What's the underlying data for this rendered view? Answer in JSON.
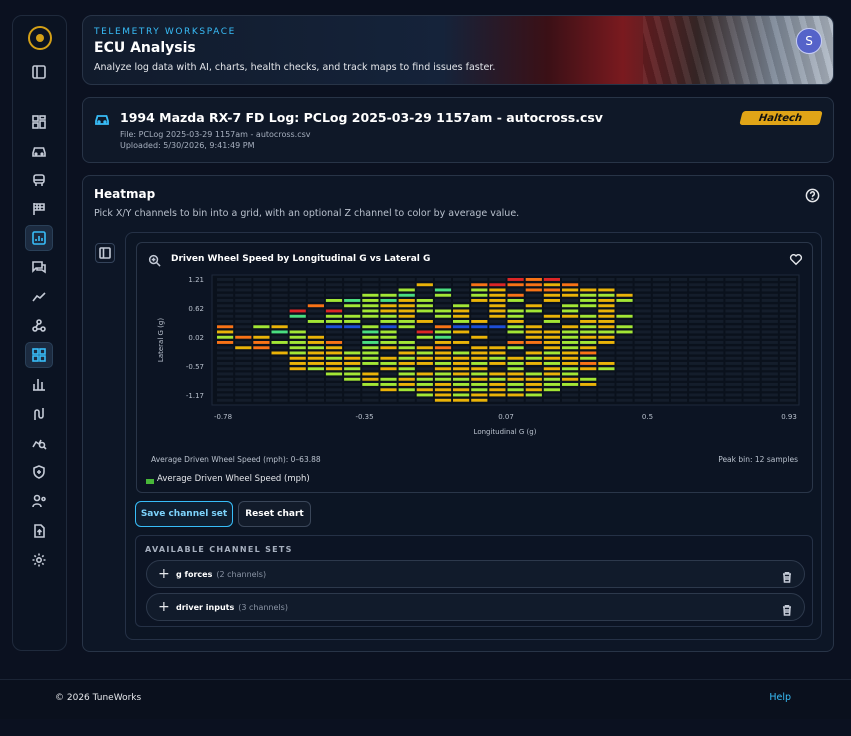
{
  "banner": {
    "workspace": "TELEMETRY WORKSPACE",
    "title": "ECU Analysis",
    "subtitle": "Analyze log data with AI, charts, health checks, and track maps to find issues faster.",
    "avatar_initial": "S"
  },
  "log": {
    "title": "1994 Mazda RX-7 FD Log: PCLog 2025-03-29 1157am - autocross.csv",
    "file": "File: PCLog 2025-03-29 1157am - autocross.csv",
    "uploaded": "Uploaded: 5/30/2026, 9:41:49 PM",
    "brand": "Haltech"
  },
  "sidebar": {
    "icons": [
      "dashboard-icon",
      "car-icon",
      "vehicle-icon",
      "flag-icon",
      "heatmap-icon",
      "chat-icon",
      "line-chart-icon",
      "graph-icon",
      "grid-icon",
      "bar-chart-icon",
      "route-icon",
      "analytics-icon",
      "shield-icon",
      "user-settings-icon",
      "upload-icon",
      "settings-icon"
    ],
    "active": "heatmap-icon"
  },
  "heatmap": {
    "title": "Heatmap",
    "subtitle": "Pick X/Y channels to bin into a grid, with an optional Z channel to color by average value.",
    "chart_title": "Driven Wheel Speed by Longitudinal G vs Lateral G",
    "range_label": "Average Driven Wheel Speed (mph): 0–63.88",
    "peak_label": "Peak bin: 12 samples",
    "legend_label": "Average Driven Wheel Speed (mph)",
    "save_button": "Save channel set",
    "reset_button": "Reset chart",
    "sets_label": "AVAILABLE CHANNEL SETS",
    "sets": [
      {
        "name": "g forces",
        "count": "(2 channels)"
      },
      {
        "name": "driver inputs",
        "count": "(3 channels)"
      }
    ]
  },
  "chart_data": {
    "type": "heatmap",
    "title": "Driven Wheel Speed by Longitudinal G vs Lateral G",
    "xlabel": "Longitudinal G (g)",
    "ylabel": "Lateral G (g)",
    "x_ticks": [
      "-0.78",
      "-0.35",
      "0.07",
      "0.5",
      "0.93"
    ],
    "y_ticks": [
      "1.21",
      "0.62",
      "0.02",
      "-0.57",
      "-1.17"
    ],
    "xlim": [
      -0.78,
      0.93
    ],
    "ylim": [
      -1.17,
      1.21
    ],
    "zlabel": "Average Driven Wheel Speed (mph)",
    "zlim": [
      0,
      63.88
    ],
    "peak_bin_samples": 12,
    "grid": {
      "cols": 32,
      "rows": 24
    },
    "colorscale": [
      "#1d4ed8",
      "#dc2626",
      "#f97316",
      "#eab308",
      "#a3e635",
      "#4ade80"
    ],
    "cells": [
      [
        0,
        16,
        1
      ],
      [
        0,
        17,
        2
      ],
      [
        0,
        18,
        1
      ],
      [
        1,
        11,
        3
      ],
      [
        1,
        14,
        2
      ],
      [
        1,
        15,
        1
      ],
      [
        1,
        16,
        2
      ],
      [
        1,
        17,
        2
      ],
      [
        1,
        18,
        3
      ],
      [
        1,
        19,
        2
      ],
      [
        2,
        10,
        4
      ],
      [
        2,
        12,
        5
      ],
      [
        2,
        14,
        4
      ],
      [
        2,
        15,
        3
      ],
      [
        2,
        17,
        2
      ],
      [
        2,
        18,
        2
      ],
      [
        2,
        19,
        3
      ],
      [
        2,
        20,
        3
      ],
      [
        2,
        21,
        3
      ],
      [
        3,
        8,
        4
      ],
      [
        3,
        9,
        4
      ],
      [
        3,
        10,
        5
      ],
      [
        3,
        12,
        4
      ],
      [
        3,
        14,
        4
      ],
      [
        3,
        15,
        3
      ],
      [
        3,
        16,
        2
      ],
      [
        3,
        18,
        3
      ],
      [
        3,
        19,
        3
      ],
      [
        3,
        20,
        4
      ],
      [
        3,
        21,
        4
      ],
      [
        3,
        22,
        3
      ],
      [
        4,
        6,
        4
      ],
      [
        4,
        7,
        5
      ],
      [
        4,
        8,
        4
      ],
      [
        4,
        9,
        5
      ],
      [
        4,
        10,
        3
      ],
      [
        4,
        11,
        4
      ],
      [
        4,
        14,
        3
      ],
      [
        4,
        15,
        3
      ],
      [
        4,
        16,
        4
      ],
      [
        4,
        18,
        3
      ],
      [
        4,
        20,
        4
      ],
      [
        4,
        21,
        3
      ],
      [
        4,
        22,
        4
      ],
      [
        5,
        5,
        2
      ],
      [
        5,
        7,
        4
      ],
      [
        5,
        8,
        4
      ],
      [
        5,
        9,
        3
      ],
      [
        5,
        10,
        3
      ],
      [
        5,
        11,
        4
      ],
      [
        5,
        13,
        4
      ],
      [
        5,
        15,
        3
      ],
      [
        5,
        17,
        3
      ],
      [
        5,
        19,
        4
      ],
      [
        5,
        20,
        4
      ],
      [
        5,
        21,
        3
      ],
      [
        6,
        4,
        1
      ],
      [
        6,
        6,
        1
      ],
      [
        6,
        8,
        4
      ],
      [
        6,
        9,
        3
      ],
      [
        6,
        10,
        3
      ],
      [
        6,
        11,
        4
      ],
      [
        6,
        12,
        4
      ],
      [
        6,
        13,
        3
      ],
      [
        6,
        15,
        3
      ],
      [
        6,
        16,
        4
      ],
      [
        6,
        17,
        4
      ],
      [
        6,
        19,
        4
      ],
      [
        6,
        21,
        3
      ],
      [
        7,
        4,
        5
      ],
      [
        7,
        6,
        4
      ],
      [
        7,
        7,
        4
      ],
      [
        7,
        8,
        4
      ],
      [
        7,
        9,
        4
      ],
      [
        7,
        10,
        3
      ],
      [
        7,
        12,
        4
      ],
      [
        7,
        13,
        3
      ],
      [
        7,
        15,
        3
      ],
      [
        7,
        16,
        4
      ],
      [
        7,
        18,
        3
      ],
      [
        7,
        19,
        3
      ],
      [
        7,
        20,
        4
      ],
      [
        7,
        21,
        3
      ],
      [
        7,
        22,
        4
      ],
      [
        8,
        5,
        4
      ],
      [
        8,
        6,
        4
      ],
      [
        8,
        7,
        4
      ],
      [
        8,
        9,
        4
      ],
      [
        8,
        10,
        4
      ],
      [
        8,
        11,
        3
      ],
      [
        8,
        13,
        4
      ],
      [
        8,
        14,
        3
      ],
      [
        8,
        16,
        3
      ],
      [
        8,
        18,
        4
      ],
      [
        8,
        20,
        3
      ],
      [
        8,
        21,
        3
      ],
      [
        9,
        0,
        2
      ],
      [
        9,
        2,
        4
      ],
      [
        9,
        3,
        3
      ],
      [
        9,
        6,
        0
      ],
      [
        9,
        7,
        0
      ],
      [
        9,
        8,
        4
      ],
      [
        9,
        9,
        0
      ],
      [
        9,
        10,
        4
      ],
      [
        9,
        12,
        2
      ],
      [
        9,
        13,
        0
      ],
      [
        9,
        14,
        0
      ],
      [
        9,
        15,
        0
      ],
      [
        9,
        16,
        4
      ],
      [
        9,
        17,
        3
      ],
      [
        9,
        19,
        3
      ],
      [
        9,
        20,
        4
      ],
      [
        9,
        21,
        3
      ],
      [
        9,
        22,
        4
      ],
      [
        10,
        0,
        3
      ],
      [
        10,
        3,
        5
      ],
      [
        10,
        4,
        4
      ],
      [
        10,
        8,
        5
      ],
      [
        10,
        9,
        4
      ],
      [
        10,
        11,
        1
      ],
      [
        10,
        12,
        4
      ],
      [
        10,
        13,
        3
      ],
      [
        10,
        16,
        4
      ],
      [
        10,
        17,
        3
      ],
      [
        10,
        18,
        3
      ],
      [
        10,
        19,
        4
      ],
      [
        10,
        20,
        4
      ],
      [
        10,
        21,
        4
      ],
      [
        10,
        22,
        4
      ],
      [
        11,
        0,
        4
      ],
      [
        11,
        1,
        2
      ],
      [
        11,
        2,
        3
      ],
      [
        11,
        4,
        4
      ],
      [
        11,
        5,
        3
      ],
      [
        11,
        8,
        4
      ],
      [
        11,
        9,
        4
      ],
      [
        11,
        11,
        4
      ],
      [
        11,
        12,
        5
      ],
      [
        11,
        14,
        3
      ],
      [
        11,
        17,
        3
      ],
      [
        11,
        18,
        3
      ],
      [
        11,
        19,
        4
      ],
      [
        11,
        20,
        3
      ],
      [
        11,
        21,
        3
      ],
      [
        12,
        0,
        2
      ],
      [
        12,
        2,
        2
      ],
      [
        12,
        3,
        4
      ],
      [
        12,
        4,
        4
      ],
      [
        12,
        5,
        3
      ],
      [
        12,
        6,
        2
      ],
      [
        12,
        8,
        5
      ],
      [
        12,
        9,
        4
      ],
      [
        12,
        10,
        4
      ],
      [
        12,
        12,
        3
      ],
      [
        12,
        13,
        3
      ],
      [
        12,
        16,
        2
      ],
      [
        12,
        17,
        2
      ],
      [
        12,
        18,
        3
      ],
      [
        12,
        19,
        4
      ],
      [
        12,
        20,
        4
      ],
      [
        12,
        21,
        3
      ],
      [
        13,
        1,
        3
      ],
      [
        13,
        2,
        2
      ],
      [
        13,
        4,
        4
      ],
      [
        13,
        5,
        4
      ],
      [
        13,
        6,
        3
      ],
      [
        13,
        8,
        4
      ],
      [
        13,
        9,
        3
      ],
      [
        13,
        10,
        4
      ],
      [
        13,
        11,
        3
      ],
      [
        13,
        12,
        2
      ],
      [
        13,
        14,
        3
      ],
      [
        13,
        15,
        3
      ],
      [
        13,
        16,
        4
      ],
      [
        13,
        18,
        3
      ],
      [
        13,
        19,
        4
      ],
      [
        13,
        20,
        3
      ],
      [
        14,
        3,
        3
      ],
      [
        14,
        4,
        4
      ],
      [
        14,
        5,
        3
      ],
      [
        14,
        6,
        3
      ],
      [
        14,
        7,
        4
      ],
      [
        14,
        8,
        4
      ],
      [
        14,
        10,
        3
      ],
      [
        14,
        11,
        4
      ],
      [
        14,
        12,
        3
      ],
      [
        14,
        13,
        4
      ],
      [
        14,
        14,
        3
      ],
      [
        14,
        15,
        3
      ],
      [
        14,
        17,
        3
      ],
      [
        14,
        18,
        4
      ],
      [
        14,
        19,
        3
      ],
      [
        14,
        20,
        2
      ],
      [
        15,
        4,
        3
      ],
      [
        15,
        5,
        3
      ],
      [
        15,
        6,
        4
      ],
      [
        15,
        7,
        3
      ],
      [
        15,
        8,
        4
      ],
      [
        15,
        9,
        3
      ],
      [
        15,
        10,
        4
      ],
      [
        15,
        11,
        3
      ],
      [
        15,
        12,
        3
      ],
      [
        15,
        13,
        3
      ],
      [
        15,
        14,
        3
      ],
      [
        15,
        15,
        4
      ],
      [
        15,
        16,
        3
      ],
      [
        15,
        17,
        4
      ],
      [
        15,
        18,
        3
      ],
      [
        15,
        19,
        3
      ],
      [
        15,
        20,
        4
      ],
      [
        16,
        4,
        3
      ],
      [
        16,
        5,
        3
      ],
      [
        16,
        6,
        3
      ],
      [
        16,
        7,
        3
      ],
      [
        16,
        8,
        4
      ],
      [
        16,
        9,
        4
      ],
      [
        16,
        10,
        3
      ],
      [
        16,
        11,
        3
      ],
      [
        16,
        12,
        4
      ],
      [
        16,
        13,
        3
      ],
      [
        16,
        14,
        4
      ],
      [
        16,
        15,
        3
      ],
      [
        16,
        16,
        4
      ],
      [
        16,
        17,
        3
      ],
      [
        16,
        18,
        4
      ],
      [
        16,
        19,
        3
      ],
      [
        16,
        20,
        2
      ],
      [
        16,
        21,
        3
      ],
      [
        17,
        4,
        3
      ],
      [
        17,
        5,
        4
      ],
      [
        17,
        6,
        3
      ],
      [
        17,
        7,
        4
      ],
      [
        17,
        9,
        3
      ],
      [
        17,
        10,
        4
      ],
      [
        17,
        12,
        3
      ],
      [
        17,
        13,
        3
      ],
      [
        17,
        14,
        3
      ],
      [
        17,
        16,
        4
      ],
      [
        17,
        18,
        3
      ],
      [
        17,
        19,
        4
      ],
      [
        17,
        20,
        3
      ],
      [
        17,
        21,
        4
      ],
      [
        18,
        6,
        4
      ],
      [
        18,
        7,
        4
      ],
      [
        18,
        8,
        3
      ],
      [
        18,
        10,
        4
      ],
      [
        18,
        11,
        3
      ],
      [
        18,
        12,
        4
      ],
      [
        18,
        13,
        3
      ],
      [
        18,
        14,
        4
      ],
      [
        18,
        15,
        3
      ],
      [
        18,
        16,
        3
      ],
      [
        18,
        17,
        4
      ],
      [
        18,
        18,
        3
      ],
      [
        18,
        19,
        4
      ],
      [
        19,
        7,
        4
      ],
      [
        19,
        8,
        3
      ],
      [
        19,
        9,
        4
      ],
      [
        19,
        10,
        3
      ],
      [
        19,
        11,
        4
      ],
      [
        19,
        12,
        4
      ],
      [
        19,
        13,
        4
      ],
      [
        19,
        14,
        3
      ],
      [
        19,
        15,
        4
      ],
      [
        19,
        16,
        3
      ],
      [
        19,
        17,
        3
      ],
      [
        19,
        18,
        4
      ],
      [
        19,
        19,
        3
      ],
      [
        19,
        20,
        4
      ],
      [
        20,
        8,
        4
      ],
      [
        20,
        9,
        4
      ],
      [
        20,
        10,
        3
      ],
      [
        20,
        11,
        4
      ],
      [
        20,
        12,
        3
      ],
      [
        20,
        13,
        4
      ],
      [
        20,
        14,
        4
      ],
      [
        20,
        15,
        3
      ],
      [
        20,
        16,
        4
      ],
      [
        20,
        17,
        3
      ],
      [
        20,
        18,
        4
      ],
      [
        20,
        19,
        4
      ],
      [
        20,
        20,
        3
      ],
      [
        21,
        9,
        3
      ],
      [
        21,
        10,
        4
      ],
      [
        21,
        11,
        3
      ],
      [
        21,
        12,
        3
      ],
      [
        21,
        13,
        3
      ],
      [
        21,
        14,
        4
      ],
      [
        21,
        15,
        3
      ],
      [
        21,
        16,
        4
      ],
      [
        21,
        17,
        3
      ],
      [
        21,
        18,
        4
      ],
      [
        22,
        11,
        4
      ],
      [
        22,
        12,
        3
      ],
      [
        22,
        13,
        4
      ],
      [
        22,
        14,
        3
      ],
      [
        22,
        15,
        3
      ],
      [
        22,
        16,
        3
      ],
      [
        22,
        17,
        4
      ],
      [
        23,
        12,
        3
      ],
      [
        23,
        13,
        3
      ],
      [
        23,
        14,
        3
      ]
    ]
  },
  "footer": {
    "copyright": "© 2026 TuneWorks",
    "help": "Help"
  }
}
